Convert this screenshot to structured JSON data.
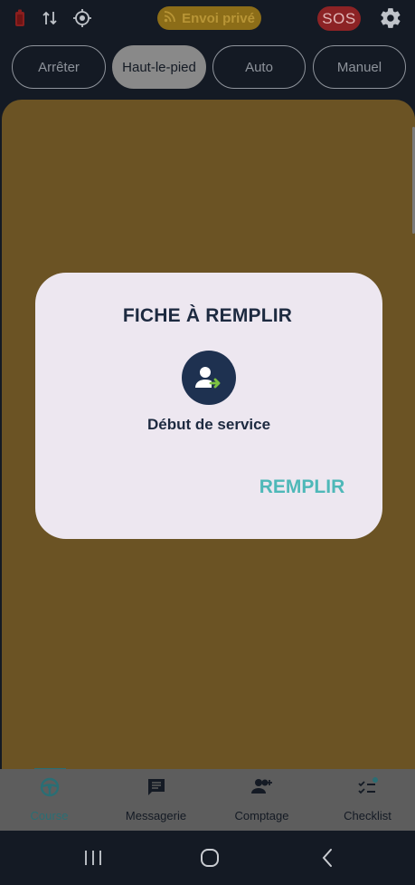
{
  "topbar": {
    "battery_icon": "battery-icon",
    "data_icon": "swap-vertical-icon",
    "location_icon": "gps-target-icon",
    "envoi_label": "Envoi privé",
    "envoi_icon": "rss-feed-icon",
    "sos_label": "SOS",
    "settings_icon": "gear-icon",
    "colors": {
      "envoi_bg": "#8c6d18",
      "sos_bg": "#8c2325"
    }
  },
  "modes": {
    "items": [
      {
        "label": "Arrêter",
        "active": false
      },
      {
        "label": "Haut-le-pied",
        "active": true
      },
      {
        "label": "Auto",
        "active": false
      },
      {
        "label": "Manuel",
        "active": false
      }
    ]
  },
  "dialog": {
    "title": "FICHE À REMPLIR",
    "icon": "person-arrow-right-icon",
    "subtitle": "Début de service",
    "action_label": "REMPLIR",
    "colors": {
      "avatar_bg": "#1e3150",
      "action": "#4eb8b8"
    }
  },
  "tabs": {
    "items": [
      {
        "label": "Course",
        "icon": "steering-wheel-icon",
        "active": true
      },
      {
        "label": "Messagerie",
        "icon": "message-icon",
        "active": false
      },
      {
        "label": "Comptage",
        "icon": "people-add-icon",
        "active": false
      },
      {
        "label": "Checklist",
        "icon": "checklist-icon",
        "active": false,
        "badge": true
      }
    ]
  },
  "system_nav": {
    "recents_icon": "recents-icon",
    "home_icon": "home-icon",
    "back_icon": "back-icon"
  }
}
